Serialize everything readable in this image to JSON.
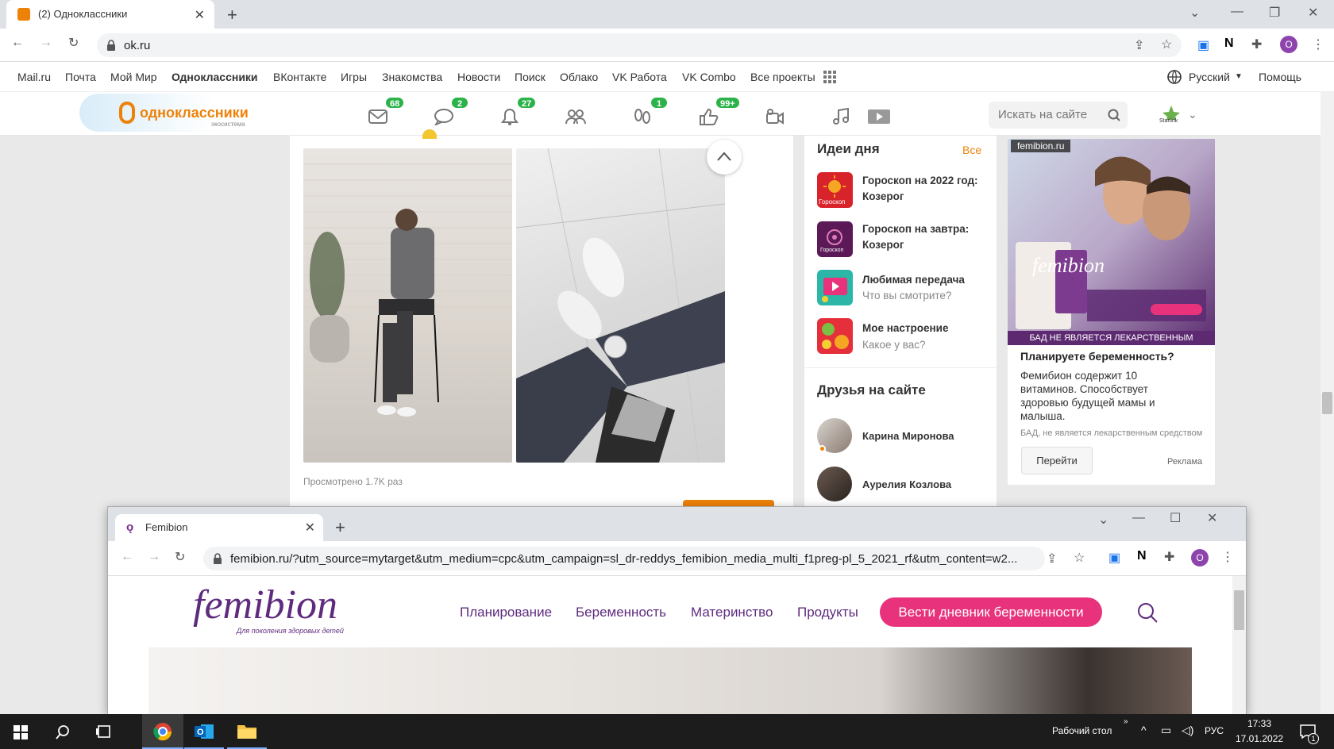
{
  "browser1": {
    "tab_title": "(2) Одноклассники",
    "url": "ok.ru",
    "profile_initial": "O"
  },
  "portal": {
    "links": [
      "Mail.ru",
      "Почта",
      "Мой Мир",
      "Одноклассники",
      "ВКонтакте",
      "Игры",
      "Знакомства",
      "Новости",
      "Поиск",
      "Облако",
      "VK Работа",
      "VK Combo",
      "Все проекты"
    ],
    "language": "Русский",
    "help": "Помощь"
  },
  "ok": {
    "logo_text": "одноклассники",
    "logo_sub": "экосистема",
    "badges": {
      "messages": "68",
      "discussions": "2",
      "notifications": "27",
      "guests": "1",
      "likes": "99+"
    },
    "search_placeholder": "Искать на сайте",
    "user_label": "Starlink"
  },
  "feed": {
    "views": "Просмотрено 1.7K раз"
  },
  "ideas": {
    "title": "Идеи дня",
    "all": "Все",
    "items": [
      {
        "title": "Гороскоп на 2022 год: Козерог",
        "sub": "",
        "icon_text": "Гороскоп",
        "color": "#d8232a"
      },
      {
        "title": "Гороскоп на завтра: Козерог",
        "sub": "",
        "icon_text": "Гороскоп",
        "color": "#5b1a57"
      },
      {
        "title": "Любимая передача",
        "sub": "Что вы смотрите?",
        "icon_text": "",
        "color": "#2bb6a8"
      },
      {
        "title": "Мое настроение",
        "sub": "Какое у вас?",
        "icon_text": "",
        "color": "#e5303b"
      }
    ]
  },
  "friends": {
    "title": "Друзья на сайте",
    "items": [
      "Карина Миронова",
      "Аурелия Козлова"
    ]
  },
  "ad": {
    "source": "femibion.ru",
    "brand": "femibion",
    "strip": "БАД НЕ ЯВЛЯЕТСЯ ЛЕКАРСТВЕННЫМ СРЕДСТВОМ",
    "headline": "Планируете беременность?",
    "text": "Фемибион содержит 10 витаминов. Способствует здоровью будущей мамы и малыша.",
    "disclaimer": "БАД, не является лекарственным средством",
    "button": "Перейти",
    "label": "Реклама"
  },
  "browser2": {
    "tab_title": "Femibion",
    "url": "femibion.ru/?utm_source=mytarget&utm_medium=cpc&utm_campaign=sl_dr-reddys_femibion_media_multi_f1preg-pl_5_2021_rf&utm_content=w2...",
    "profile_initial": "O"
  },
  "femibion": {
    "logo": "femibion",
    "logo_sub": "Для поколения здоровых детей",
    "nav": [
      "Планирование",
      "Беременность",
      "Материнство",
      "Продукты"
    ],
    "cta": "Вести дневник беременности"
  },
  "taskbar": {
    "desktop_label": "Рабочий стол",
    "lang": "РУС",
    "time": "17:33",
    "date": "17.01.2022",
    "notif_count": "1"
  }
}
